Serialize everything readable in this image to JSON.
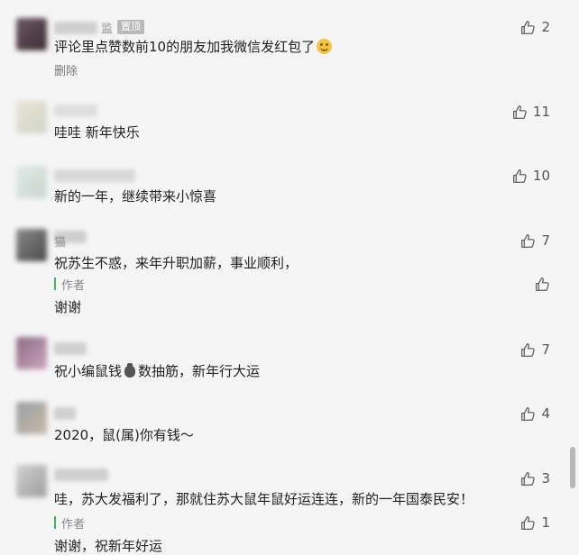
{
  "icons": {
    "thumb": "thumbs-up-outline-icon",
    "emoji": "grinning-face-icon",
    "money": "money-bag-icon"
  },
  "colors": {
    "background": "#f5f5f5",
    "author_bar": "#3eb94e",
    "badge_bg": "#b9b9b9",
    "text": "#222222",
    "muted": "#888888"
  },
  "comments": [
    {
      "name_tail": "监",
      "badge": "置顶",
      "text": "评论里点赞数前10的朋友加我微信发红包了",
      "delete": "删除",
      "likes": "2"
    },
    {
      "text": "哇哇 新年快乐",
      "likes": "11"
    },
    {
      "text": "新的一年，继续带来小惊喜",
      "likes": "10"
    },
    {
      "name_tail": "猫",
      "text": "祝苏生不惑，来年升职加薪，事业顺利，",
      "likes": "7",
      "reply": {
        "tag": "作者",
        "text": "谢谢",
        "likes": ""
      }
    },
    {
      "text_before": "祝小编鼠钱",
      "text_after": "数抽筋，新年行大运",
      "likes": "7"
    },
    {
      "text": "2020，鼠(属)你有钱～",
      "likes": "4"
    },
    {
      "text": "哇，苏大发福利了，那就住苏大鼠年鼠好运连连，新的一年国泰民安！",
      "likes": "3",
      "reply": {
        "tag": "作者",
        "text": "谢谢，祝新年好运",
        "likes": "1"
      }
    }
  ]
}
